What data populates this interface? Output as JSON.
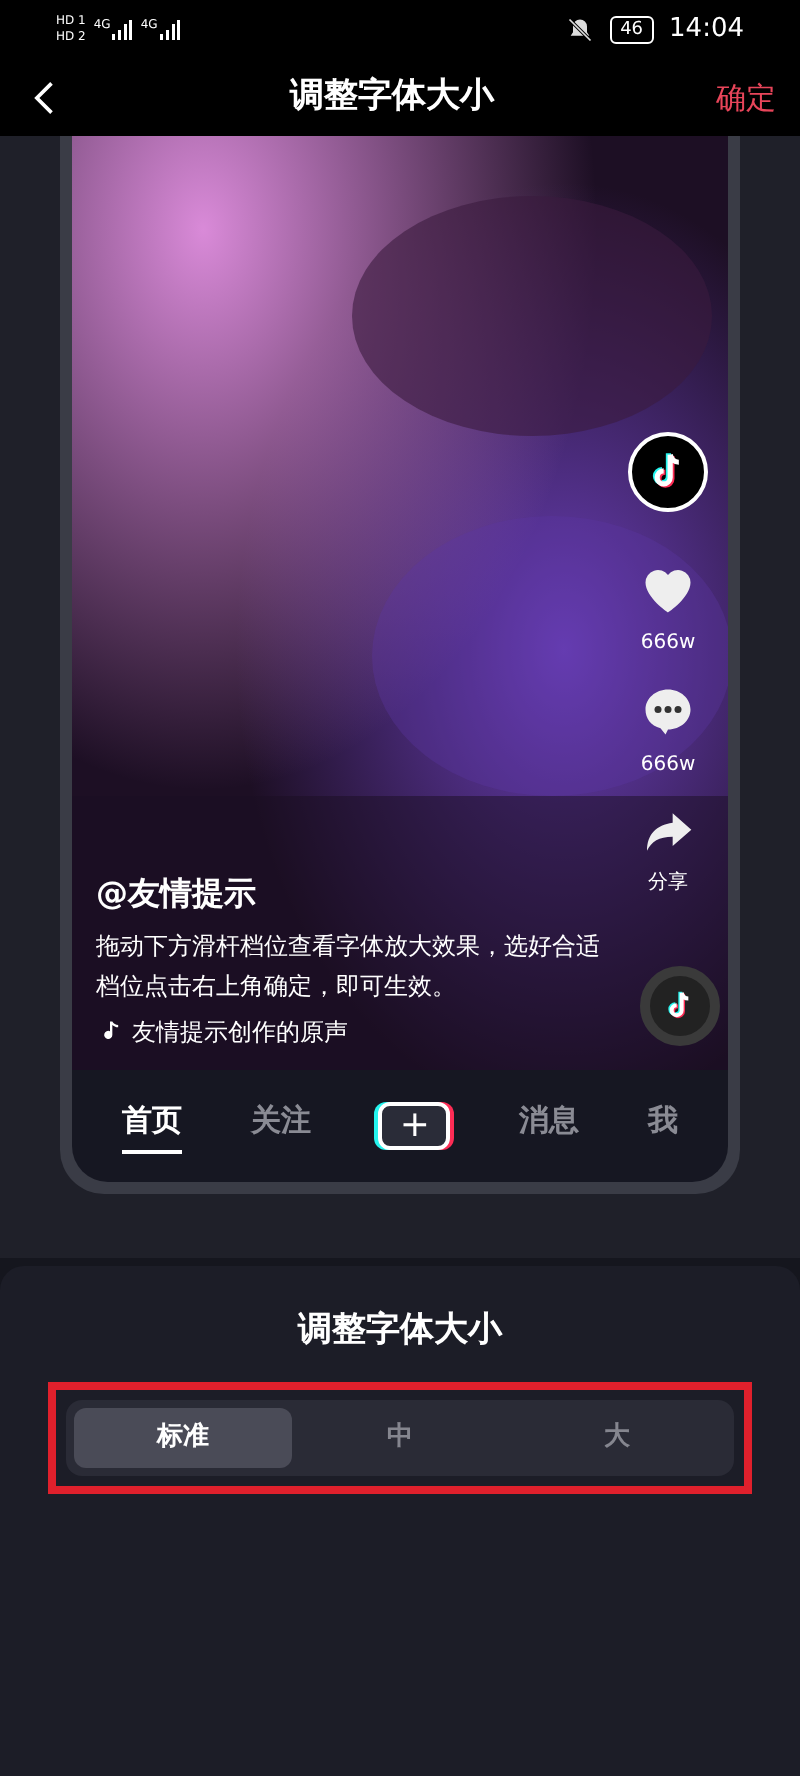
{
  "status_bar": {
    "sims": [
      "HD 1",
      "HD 2"
    ],
    "networks": [
      "4G",
      "4G"
    ],
    "battery": "46",
    "time": "14:04"
  },
  "header": {
    "title": "调整字体大小",
    "confirm": "确定"
  },
  "preview": {
    "actions": [
      {
        "kind": "avatar"
      },
      {
        "kind": "like",
        "label": "666w"
      },
      {
        "kind": "comment",
        "label": "666w"
      },
      {
        "kind": "share",
        "label": "分享"
      }
    ],
    "author": "@友情提示",
    "caption": "拖动下方滑杆档位查看字体放大效果，选好合适档位点击右上角确定，即可生效。",
    "music": "友情提示创作的原声",
    "tabs": [
      {
        "kind": "text",
        "label": "首页",
        "selected": true
      },
      {
        "kind": "text",
        "label": "关注",
        "selected": false
      },
      {
        "kind": "plus",
        "label": "+",
        "selected": false
      },
      {
        "kind": "text",
        "label": "消息",
        "selected": false
      },
      {
        "kind": "text",
        "label": "我",
        "selected": false
      }
    ]
  },
  "panel": {
    "title": "调整字体大小",
    "highlighted": true,
    "options": [
      {
        "label": "标准",
        "selected": true
      },
      {
        "label": "中",
        "selected": false
      },
      {
        "label": "大",
        "selected": false
      }
    ]
  }
}
